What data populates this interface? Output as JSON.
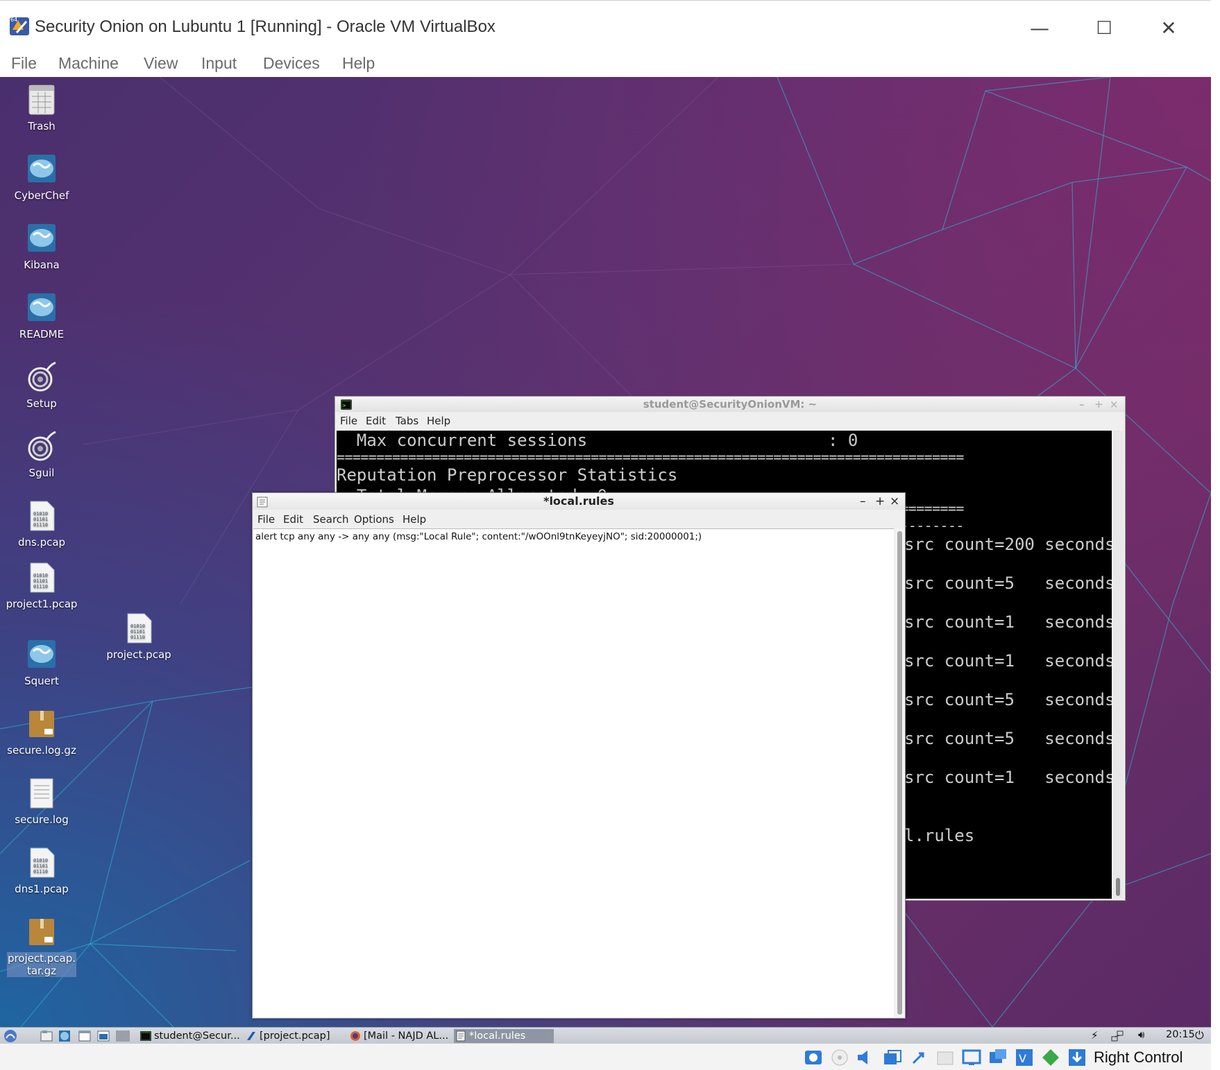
{
  "vbox": {
    "title": "Security Onion on Lubuntu 1 [Running] - Oracle VM VirtualBox",
    "menu": [
      "File",
      "Machine",
      "View",
      "Input",
      "Devices",
      "Help"
    ],
    "controls": {
      "minimize": "—",
      "maximize": "☐",
      "close": "✕"
    },
    "status_right_text": "Right Control"
  },
  "desktop_icons": [
    {
      "label": "Trash",
      "icon": "trash-icon"
    },
    {
      "label": "CyberChef",
      "icon": "globe-app-icon"
    },
    {
      "label": "Kibana",
      "icon": "globe-app-icon"
    },
    {
      "label": "README",
      "icon": "globe-app-icon"
    },
    {
      "label": "Setup",
      "icon": "onion-icon"
    },
    {
      "label": "Sguil",
      "icon": "onion-icon"
    },
    {
      "label": "dns.pcap",
      "icon": "binary-file-icon"
    },
    {
      "label": "project1.pcap",
      "icon": "binary-file-icon"
    },
    {
      "label": "Squert",
      "icon": "globe-app-icon"
    },
    {
      "label": "secure.log.gz",
      "icon": "archive-icon"
    },
    {
      "label": "secure.log",
      "icon": "text-file-icon"
    },
    {
      "label": "dns1.pcap",
      "icon": "binary-file-icon"
    },
    {
      "label": "project.pcap.tar.gz",
      "icon": "archive-icon"
    },
    {
      "label": "project.pcap",
      "icon": "binary-file-icon"
    }
  ],
  "terminal": {
    "title": "student@SecurityOnionVM: ~",
    "controls": {
      "minimize": "–",
      "maximize": "+",
      "close": "×"
    },
    "menu": [
      "File",
      "Edit",
      "Tabs",
      "Help"
    ],
    "lines": [
      "  Max concurrent sessions                        : 0",
      "===============================================================================",
      "Reputation Preprocessor Statistics",
      "  Total Memory Allocated: 0",
      "===============================================================================",
      "-------------------------------------------------------------------------------",
      "src count=200 seconds=",
      "src count=5   seconds=",
      "src count=1   seconds=",
      "src count=1   seconds=",
      "src count=5   seconds=",
      "src count=5   seconds=",
      "src count=1   seconds=",
      "l.rules"
    ]
  },
  "editor": {
    "title": "*local.rules",
    "controls": {
      "minimize": "–",
      "maximize": "+",
      "close": "×"
    },
    "menu": [
      "File",
      "Edit",
      "Search",
      "Options",
      "Help"
    ],
    "content": "alert tcp any any -> any any (msg:\"Local Rule\"; content:\"/wOOnl9tnKeyeyjNO\"; sid:20000001;)"
  },
  "taskbar": {
    "tasks": [
      "student@Secur...",
      "[project.pcap]",
      "[Mail - NAJD AL...",
      "*local.rules"
    ],
    "clock": "20:15"
  },
  "colors": {
    "accent": "#8e96a4",
    "wallpaper_purple": "#5a3270",
    "wallpaper_blue": "#1d6ea8"
  }
}
